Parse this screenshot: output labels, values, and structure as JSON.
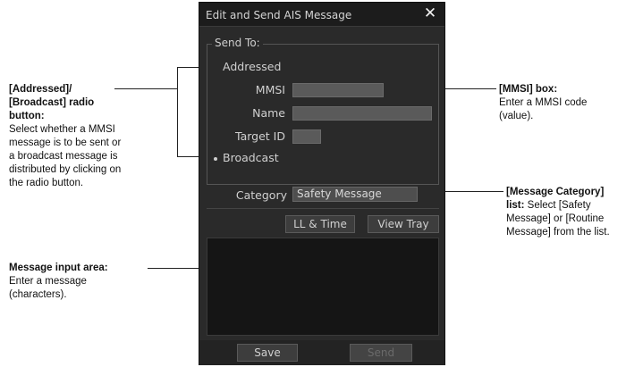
{
  "dialog": {
    "title": "Edit and Send AIS Message",
    "close_glyph": "✕",
    "send_to_legend": "Send To:",
    "addressed_label": "Addressed",
    "mmsi_label": "MMSI",
    "mmsi_value": "",
    "name_label": "Name",
    "name_value": "",
    "target_id_label": "Target ID",
    "target_id_value": "",
    "broadcast_label": "Broadcast",
    "selected_recipient": "Broadcast",
    "category_label": "Category",
    "category_value": "Safety Message",
    "ll_time_button": "LL & Time",
    "view_tray_button": "View Tray",
    "message_text": "",
    "save_button": "Save",
    "send_button": "Send"
  },
  "callouts": {
    "radio": {
      "title_line1": "[Addressed]/",
      "title_line2": "[Broadcast] radio",
      "title_line3": "button:",
      "body_line1": "Select whether a MMSI",
      "body_line2": "message is to be sent or",
      "body_line3": "a broadcast message is",
      "body_line4": "distributed by clicking on",
      "body_line5": "the radio button."
    },
    "message_area": {
      "title": "Message input area:",
      "body_line1": "Enter a message",
      "body_line2": "(characters)."
    },
    "mmsi": {
      "title": "[MMSI] box:",
      "body_line1": "Enter a MMSI code",
      "body_line2": "(value)."
    },
    "category": {
      "title_line1": "[Message Category]",
      "title_line2_bold": "list:",
      "title_line2_rest": " Select [Safety",
      "body_line1": "Message] or [Routine",
      "body_line2": "Message] from the list."
    }
  }
}
